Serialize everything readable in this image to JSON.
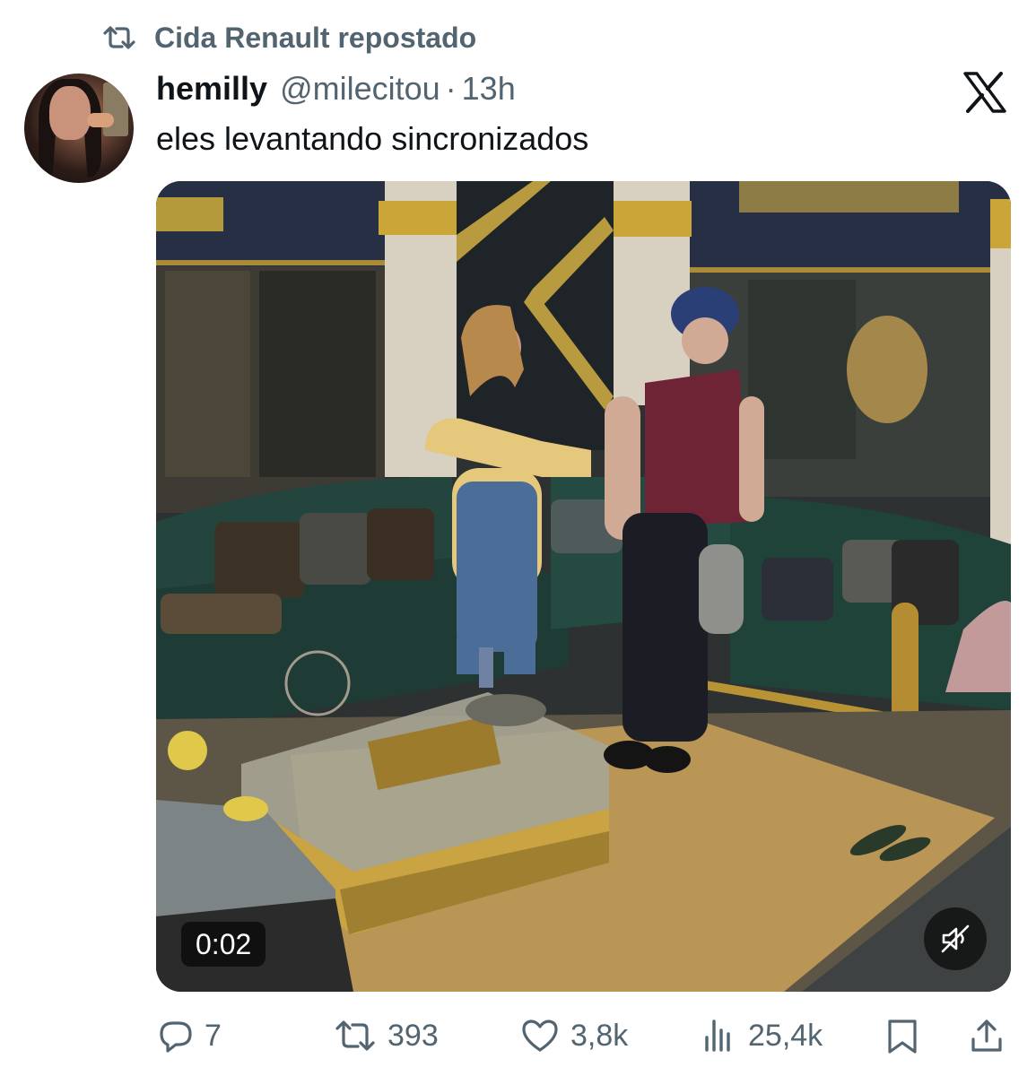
{
  "repost_banner": {
    "text": "Cida Renault repostado",
    "icon": "repost-icon"
  },
  "tweet": {
    "author_name": "hemilly",
    "author_handle": "@milecitou",
    "separator": "·",
    "time": "13h",
    "text": "eles levantando sincronizados",
    "platform_icon": "x-logo-icon"
  },
  "video": {
    "timestamp": "0:02",
    "muted": true,
    "mute_icon": "speaker-muted-icon"
  },
  "actions": {
    "replies": "7",
    "reposts": "393",
    "likes": "3,8k",
    "views": "25,4k",
    "icons": [
      "reply-icon",
      "repost-icon",
      "heart-icon",
      "views-icon",
      "bookmark-icon",
      "share-icon"
    ]
  },
  "colors": {
    "text": "#0f1419",
    "secondary": "#536471",
    "background": "#ffffff"
  }
}
